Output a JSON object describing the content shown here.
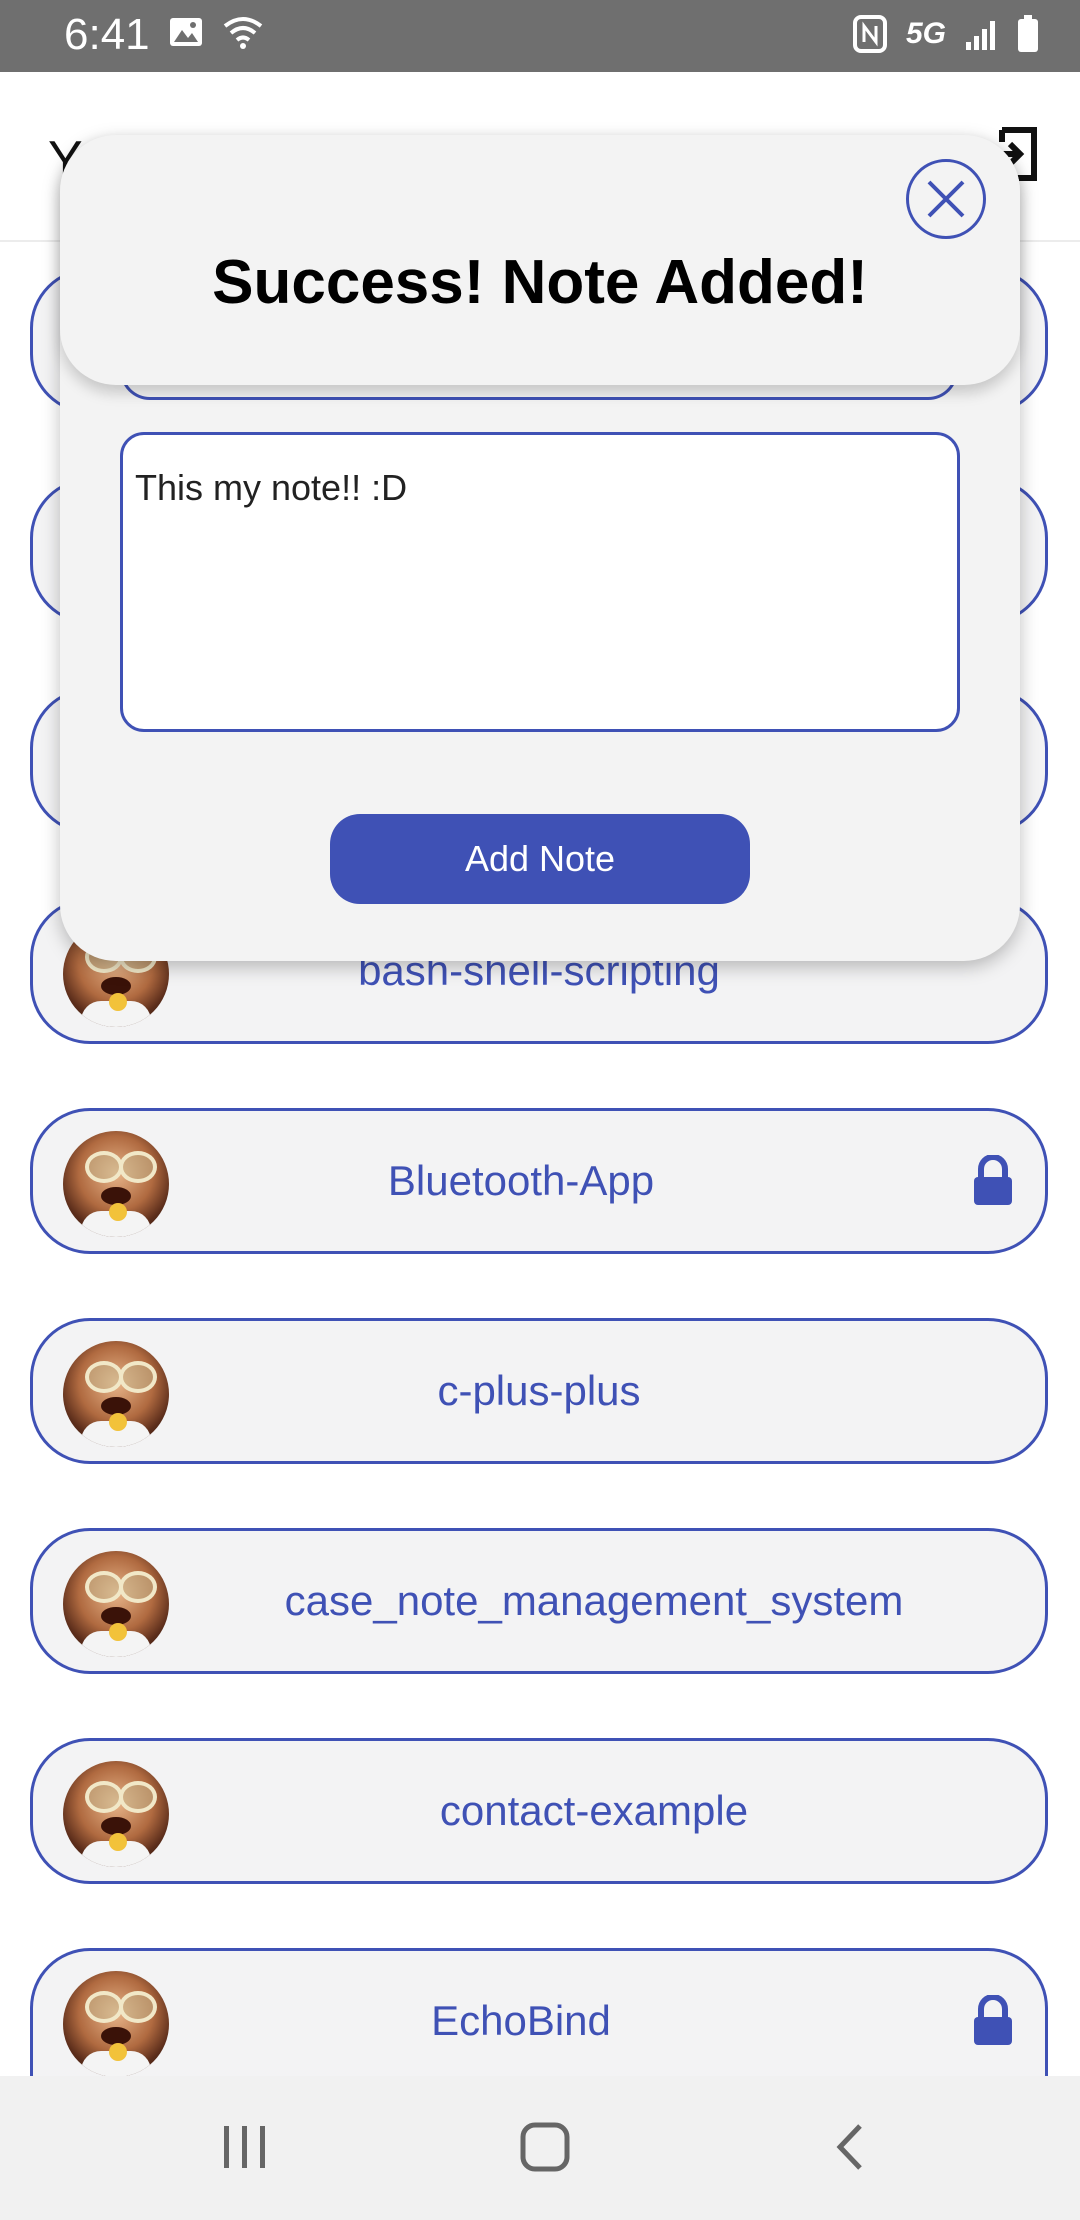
{
  "status_bar": {
    "time": "6:41",
    "network": "5G"
  },
  "header": {
    "title": "Y"
  },
  "repos": [
    {
      "name": "bash-shell-scripting",
      "locked": false
    },
    {
      "name": "Bluetooth-App",
      "locked": true
    },
    {
      "name": "c-plus-plus",
      "locked": false
    },
    {
      "name": "case_note_management_system",
      "locked": false
    },
    {
      "name": "contact-example",
      "locked": false
    },
    {
      "name": "EchoBind",
      "locked": true
    }
  ],
  "modal": {
    "toast_title": "Success! Note Added!",
    "note_value": "This my note!! :D",
    "add_button_label": "Add Note"
  },
  "colors": {
    "accent": "#3f51b5",
    "card_bg": "#f3f3f4"
  },
  "icons": {
    "close": "close-icon",
    "lock": "lock-icon",
    "logout": "logout-icon"
  }
}
